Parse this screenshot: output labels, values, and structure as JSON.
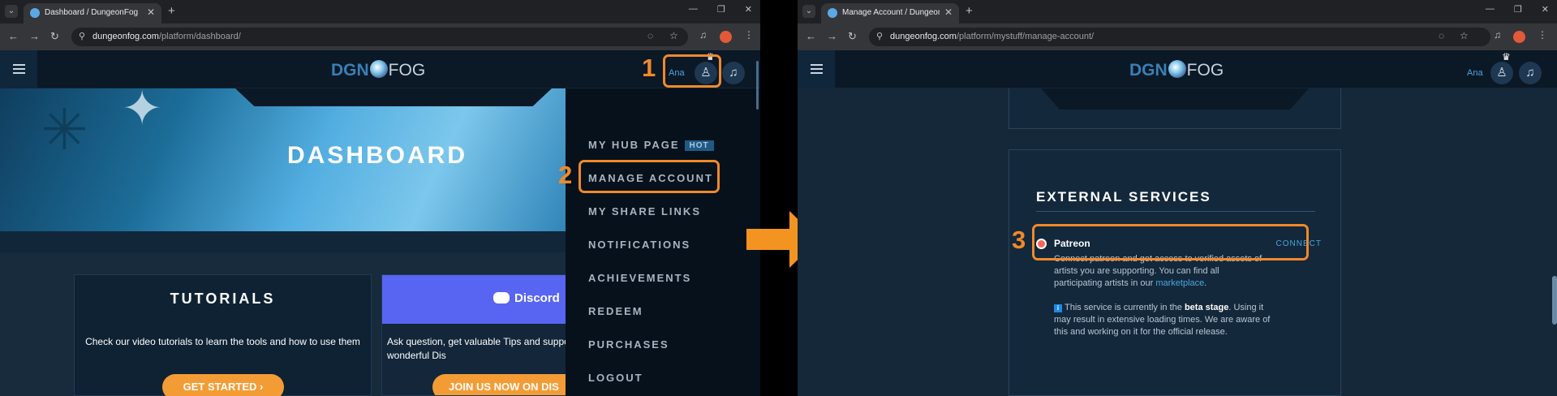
{
  "left": {
    "tab_title": "Dashboard / DungeonFog",
    "url_domain": "dungeonfog.com",
    "url_path": "/platform/dashboard/",
    "username": "Ana",
    "logo_part1": "DGN",
    "logo_part2": "FOG",
    "banner_title": "DASHBOARD",
    "tutorials": {
      "title": "TUTORIALS",
      "text": "Check our video tutorials to learn the tools and how to use them",
      "button": "GET STARTED"
    },
    "discord": {
      "logo_text": "Discord",
      "text": "Ask question, get valuable Tips and support from our wonderful Dis",
      "button": "JOIN US NOW ON DIS"
    },
    "menu": [
      {
        "label": "MY HUB PAGE",
        "badge": "HOT"
      },
      {
        "label": "MANAGE ACCOUNT"
      },
      {
        "label": "MY SHARE LINKS"
      },
      {
        "label": "NOTIFICATIONS"
      },
      {
        "label": "ACHIEVEMENTS"
      },
      {
        "label": "REDEEM"
      },
      {
        "label": "PURCHASES"
      },
      {
        "label": "LOGOUT"
      }
    ]
  },
  "right": {
    "tab_title": "Manage Account / DungeonFog",
    "url_domain": "dungeonfog.com",
    "url_path": "/platform/mystuff/manage-account/",
    "username": "Ana",
    "logo_part1": "DGN",
    "logo_part2": "FOG",
    "section_title": "EXTERNAL SERVICES",
    "service_name": "Patreon",
    "connect_label": "CONNECT",
    "desc_1": "Connect patreon and get access to verified assets of artists you are supporting. You can find all participating artists in our ",
    "desc_link": "marketplace",
    "desc_end": ".",
    "beta_1": "This service is currently in the ",
    "beta_bold": "beta stage",
    "beta_2": ". Using it may result in extensive loading times. We are aware of this and working on it for the official release."
  },
  "steps": [
    "1",
    "2",
    "3"
  ],
  "colors": {
    "accent_orange": "#f0892a",
    "link_blue": "#4aa6e0",
    "discord_blurple": "#5865f2",
    "patreon_red": "#f96854"
  }
}
